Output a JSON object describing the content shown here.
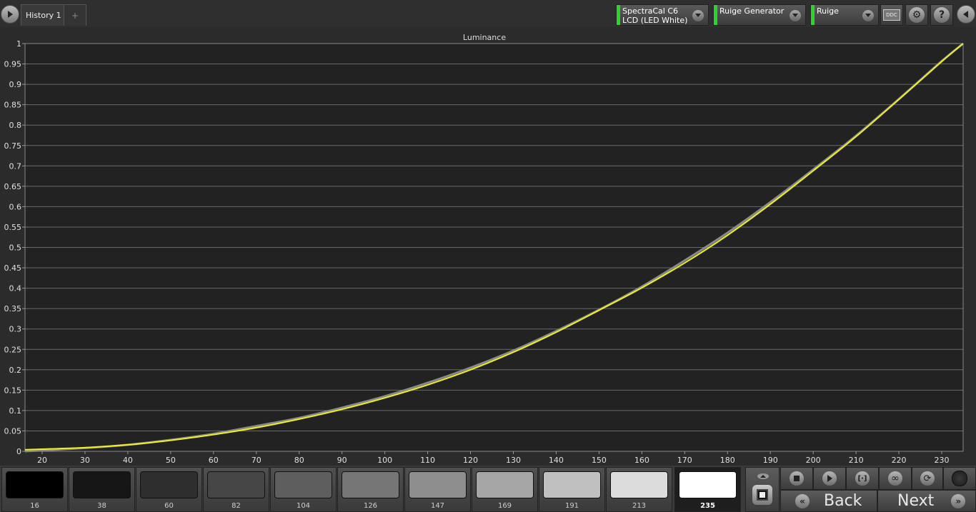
{
  "topbar": {
    "tab_label": "History 1",
    "add_tab": "+",
    "meter": {
      "line1": "SpectraCal C6",
      "line2": "LCD (LED White)"
    },
    "generator": {
      "line1": "Ruige Generator"
    },
    "display": {
      "line1": "Ruige"
    },
    "ddc_label": "DDC",
    "help_label": "?"
  },
  "chart_data": {
    "type": "line",
    "title": "Luminance",
    "xlim": [
      16,
      235
    ],
    "ylim": [
      0,
      1
    ],
    "xticks": [
      "20",
      "30",
      "40",
      "50",
      "60",
      "70",
      "80",
      "90",
      "100",
      "110",
      "120",
      "130",
      "140",
      "150",
      "160",
      "170",
      "180",
      "190",
      "200",
      "210",
      "220",
      "230"
    ],
    "yticks": [
      "0",
      "0.05",
      "0.1",
      "0.15",
      "0.2",
      "0.25",
      "0.3",
      "0.35",
      "0.4",
      "0.45",
      "0.5",
      "0.55",
      "0.6",
      "0.65",
      "0.7",
      "0.75",
      "0.8",
      "0.85",
      "0.9",
      "0.95",
      "1"
    ],
    "grid": true,
    "series": [
      {
        "color": "#8a8a8a",
        "x": [
          16,
          30,
          40,
          50,
          60,
          70,
          80,
          90,
          100,
          110,
          120,
          130,
          140,
          150,
          160,
          170,
          180,
          190,
          200,
          210,
          220,
          230,
          235
        ],
        "y": [
          0,
          0.008,
          0.016,
          0.028,
          0.043,
          0.062,
          0.082,
          0.107,
          0.135,
          0.168,
          0.205,
          0.247,
          0.295,
          0.347,
          0.404,
          0.468,
          0.536,
          0.611,
          0.691,
          0.774,
          0.864,
          0.957,
          1
        ]
      },
      {
        "color": "#f0f020",
        "x": [
          16,
          30,
          40,
          50,
          60,
          70,
          80,
          90,
          100,
          110,
          120,
          130,
          140,
          150,
          160,
          170,
          180,
          190,
          200,
          210,
          220,
          230,
          235
        ],
        "y": [
          0.004,
          0.009,
          0.016,
          0.027,
          0.041,
          0.058,
          0.079,
          0.103,
          0.131,
          0.163,
          0.2,
          0.243,
          0.292,
          0.346,
          0.401,
          0.462,
          0.53,
          0.606,
          0.688,
          0.772,
          0.863,
          0.956,
          1
        ]
      }
    ]
  },
  "swatches": [
    {
      "label": "16",
      "color": "#000000"
    },
    {
      "label": "38",
      "color": "#161616"
    },
    {
      "label": "60",
      "color": "#2e2e2e"
    },
    {
      "label": "82",
      "color": "#464646"
    },
    {
      "label": "104",
      "color": "#5e5e5e"
    },
    {
      "label": "126",
      "color": "#767676"
    },
    {
      "label": "147",
      "color": "#8e8e8e"
    },
    {
      "label": "169",
      "color": "#a6a6a6"
    },
    {
      "label": "191",
      "color": "#c0c0c0"
    },
    {
      "label": "213",
      "color": "#dcdcdc"
    },
    {
      "label": "235",
      "color": "#ffffff",
      "active": true
    }
  ],
  "controls": {
    "back_label": "Back",
    "next_label": "Next"
  }
}
